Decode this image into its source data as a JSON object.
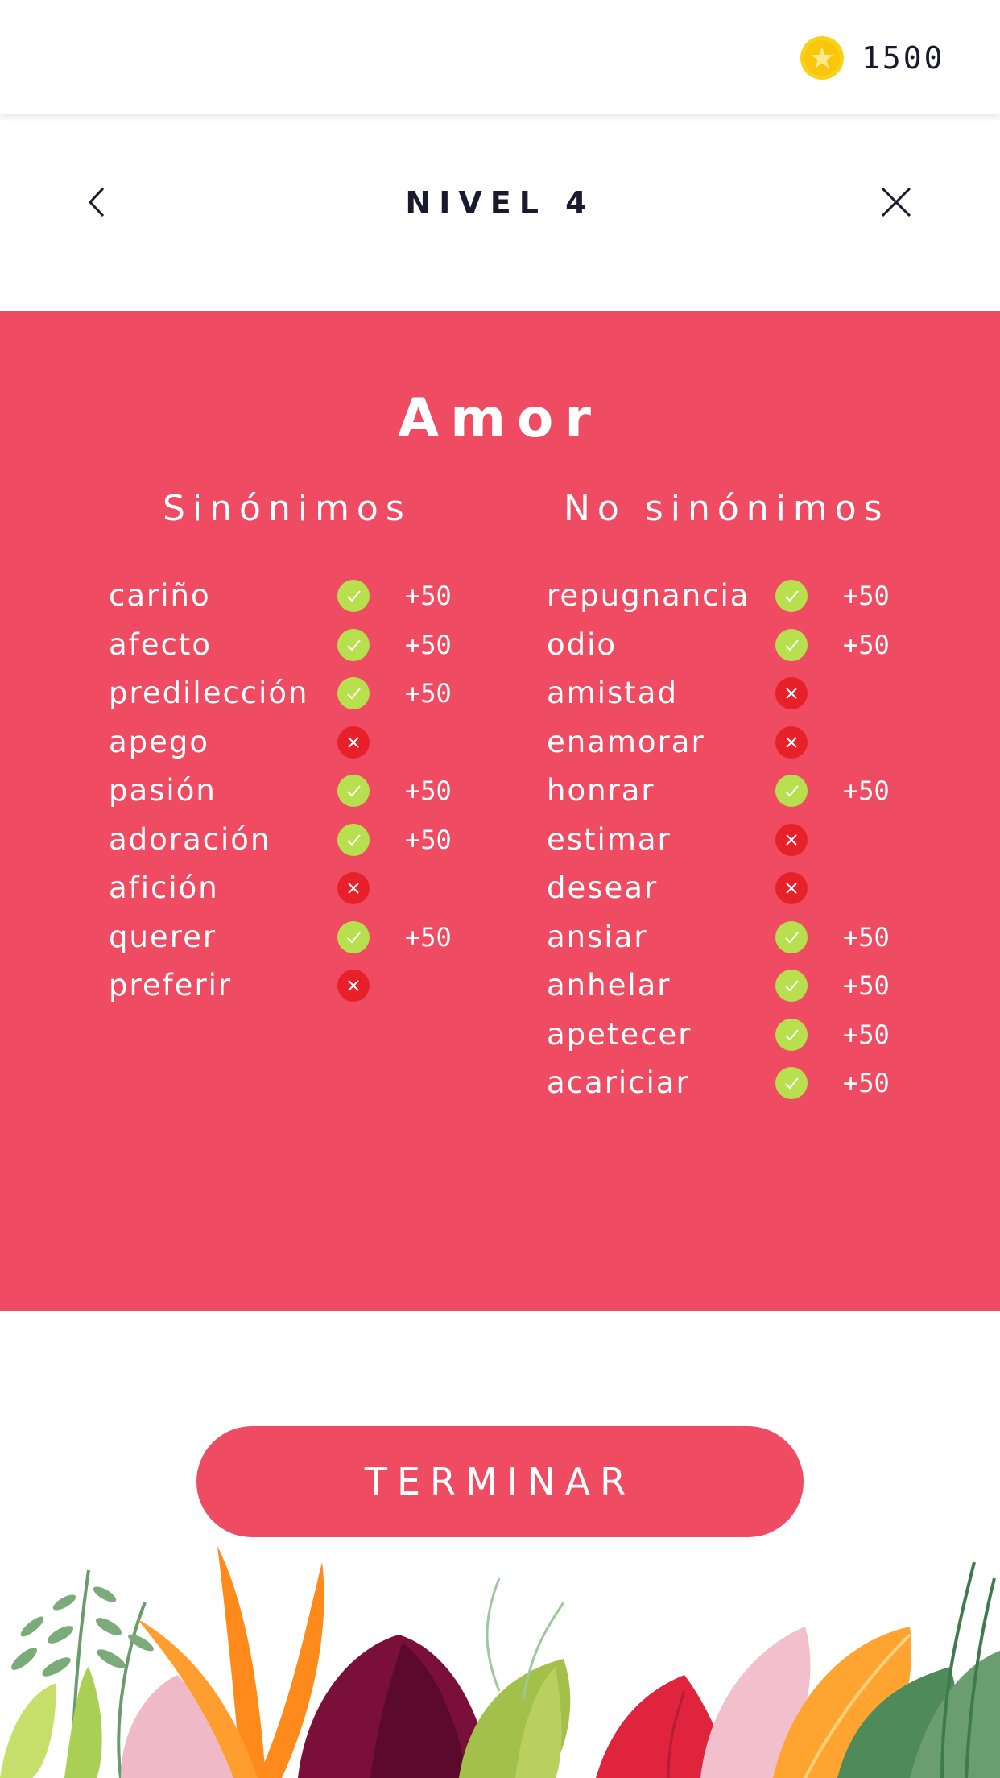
{
  "header": {
    "coins": "1500"
  },
  "nav": {
    "level_title": "NIVEL 4"
  },
  "game": {
    "word": "Amor",
    "synonyms_heading": "Sinónimos",
    "non_synonyms_heading": "No sinónimos",
    "synonyms": [
      {
        "word": "cariño",
        "correct": true,
        "points": "+50"
      },
      {
        "word": "afecto",
        "correct": true,
        "points": "+50"
      },
      {
        "word": "predilección",
        "correct": true,
        "points": "+50"
      },
      {
        "word": "apego",
        "correct": false,
        "points": ""
      },
      {
        "word": "pasión",
        "correct": true,
        "points": "+50"
      },
      {
        "word": "adoración",
        "correct": true,
        "points": "+50"
      },
      {
        "word": "afición",
        "correct": false,
        "points": ""
      },
      {
        "word": "querer",
        "correct": true,
        "points": "+50"
      },
      {
        "word": "preferir",
        "correct": false,
        "points": ""
      }
    ],
    "non_synonyms": [
      {
        "word": "repugnancia",
        "correct": true,
        "points": "+50"
      },
      {
        "word": "odio",
        "correct": true,
        "points": "+50"
      },
      {
        "word": "amistad",
        "correct": false,
        "points": ""
      },
      {
        "word": "enamorar",
        "correct": false,
        "points": ""
      },
      {
        "word": "honrar",
        "correct": true,
        "points": "+50"
      },
      {
        "word": "estimar",
        "correct": false,
        "points": ""
      },
      {
        "word": "desear",
        "correct": false,
        "points": ""
      },
      {
        "word": "ansiar",
        "correct": true,
        "points": "+50"
      },
      {
        "word": "anhelar",
        "correct": true,
        "points": "+50"
      },
      {
        "word": "apetecer",
        "correct": true,
        "points": "+50"
      },
      {
        "word": "acariciar",
        "correct": true,
        "points": "+50"
      }
    ]
  },
  "footer": {
    "finish_label": "TERMINAR"
  },
  "icons": {
    "coin": "star-coin-icon",
    "back": "chevron-left-icon",
    "close": "close-icon",
    "correct": "check-icon",
    "wrong": "x-icon"
  },
  "colors": {
    "accent": "#ef4b62",
    "correct": "#b8df4d",
    "wrong": "#e8202a",
    "coin": "#f6d21a"
  }
}
